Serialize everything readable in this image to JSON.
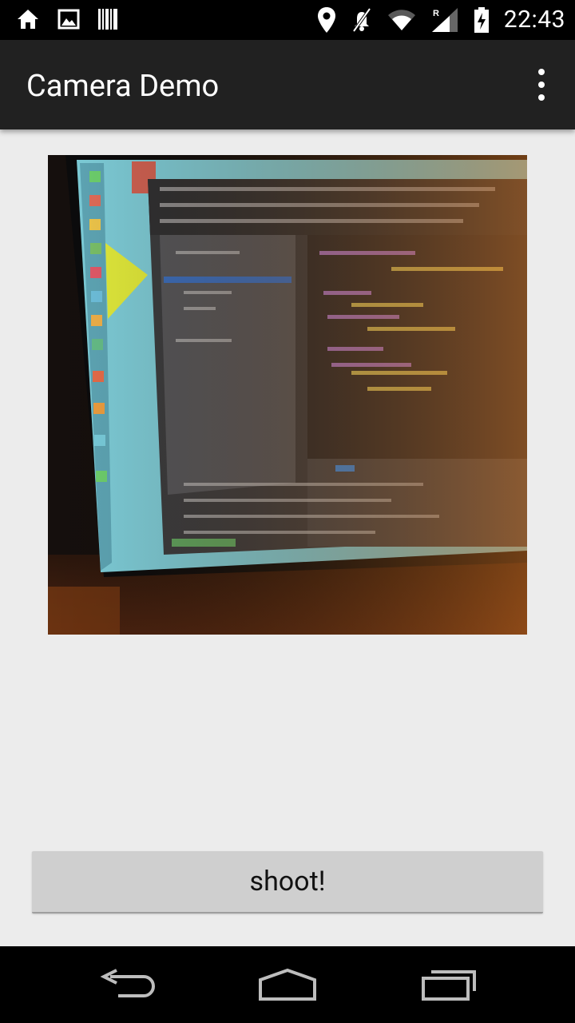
{
  "status_bar": {
    "time": "22:43",
    "icons_left": [
      "home-icon",
      "gallery-icon",
      "barcode-icon"
    ],
    "icons_right": [
      "location-icon",
      "vibrate-icon",
      "wifi-icon",
      "signal-roaming-icon",
      "battery-charging-icon"
    ]
  },
  "action_bar": {
    "title": "Camera Demo",
    "overflow_icon": "more-vert-icon"
  },
  "main": {
    "shoot_button_label": "shoot!"
  },
  "nav_bar": {
    "icons": [
      "back-icon",
      "home-nav-icon",
      "recent-apps-icon"
    ]
  },
  "colors": {
    "action_bar": "#212121",
    "background": "#ececec",
    "button": "#cfcfcf",
    "status_bar": "#000000"
  }
}
